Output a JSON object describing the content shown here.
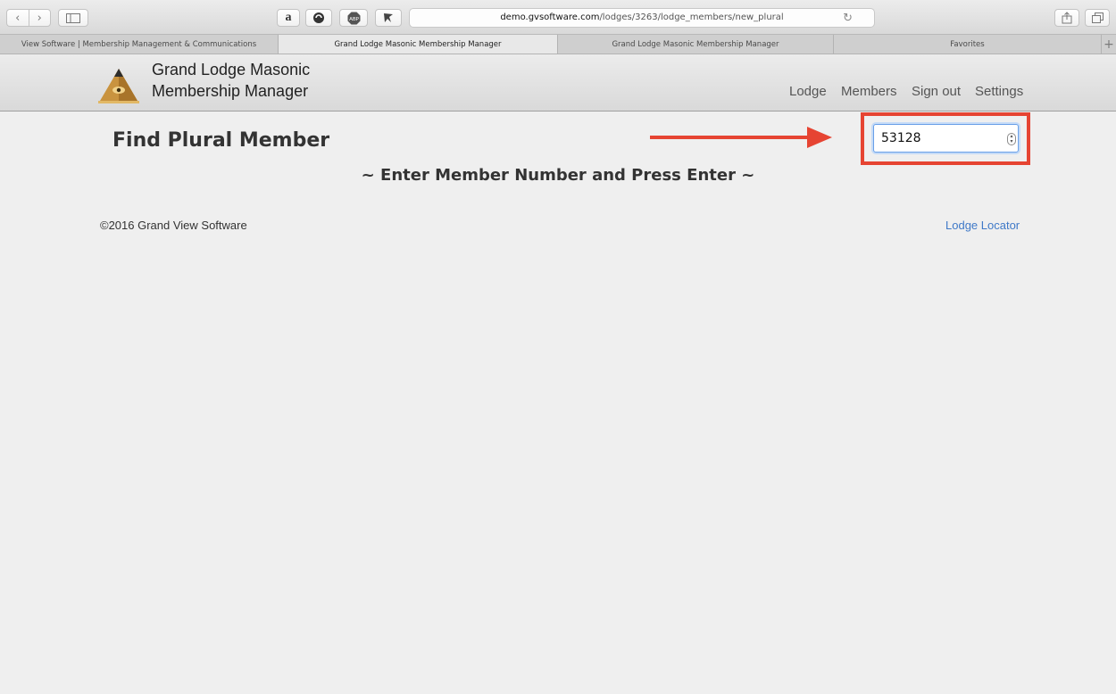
{
  "browser": {
    "url_host": "demo.gvsoftware.com",
    "url_path": "/lodges/3263/lodge_members/new_plural",
    "toolbar_icons": [
      "back-icon",
      "forward-icon",
      "sidebar-icon",
      "amazon-icon",
      "extension-icon",
      "adblock-icon",
      "extension-icon",
      "reload-icon",
      "share-icon",
      "tabs-icon"
    ],
    "tabs": [
      {
        "label": "View Software | Membership Management & Communications",
        "active": false
      },
      {
        "label": "Grand Lodge Masonic Membership Manager",
        "active": true
      },
      {
        "label": "Grand Lodge Masonic Membership Manager",
        "active": false
      },
      {
        "label": "Favorites",
        "active": false
      }
    ],
    "new_tab_label": "+"
  },
  "site": {
    "brand_line1": "Grand Lodge Masonic",
    "brand_line2": "Membership Manager",
    "nav": {
      "lodge": "Lodge",
      "members": "Members",
      "sign_out": "Sign out",
      "settings": "Settings"
    }
  },
  "main": {
    "title": "Find Plural Member",
    "subtitle": "~ Enter Member Number and Press Enter ~",
    "member_number_value": "53128"
  },
  "footer": {
    "copyright": "©2016 Grand View Software",
    "locator_link": "Lodge Locator"
  },
  "colors": {
    "annotation_red": "#e64432",
    "link_blue": "#3f79c8",
    "page_bg": "#efefef"
  }
}
